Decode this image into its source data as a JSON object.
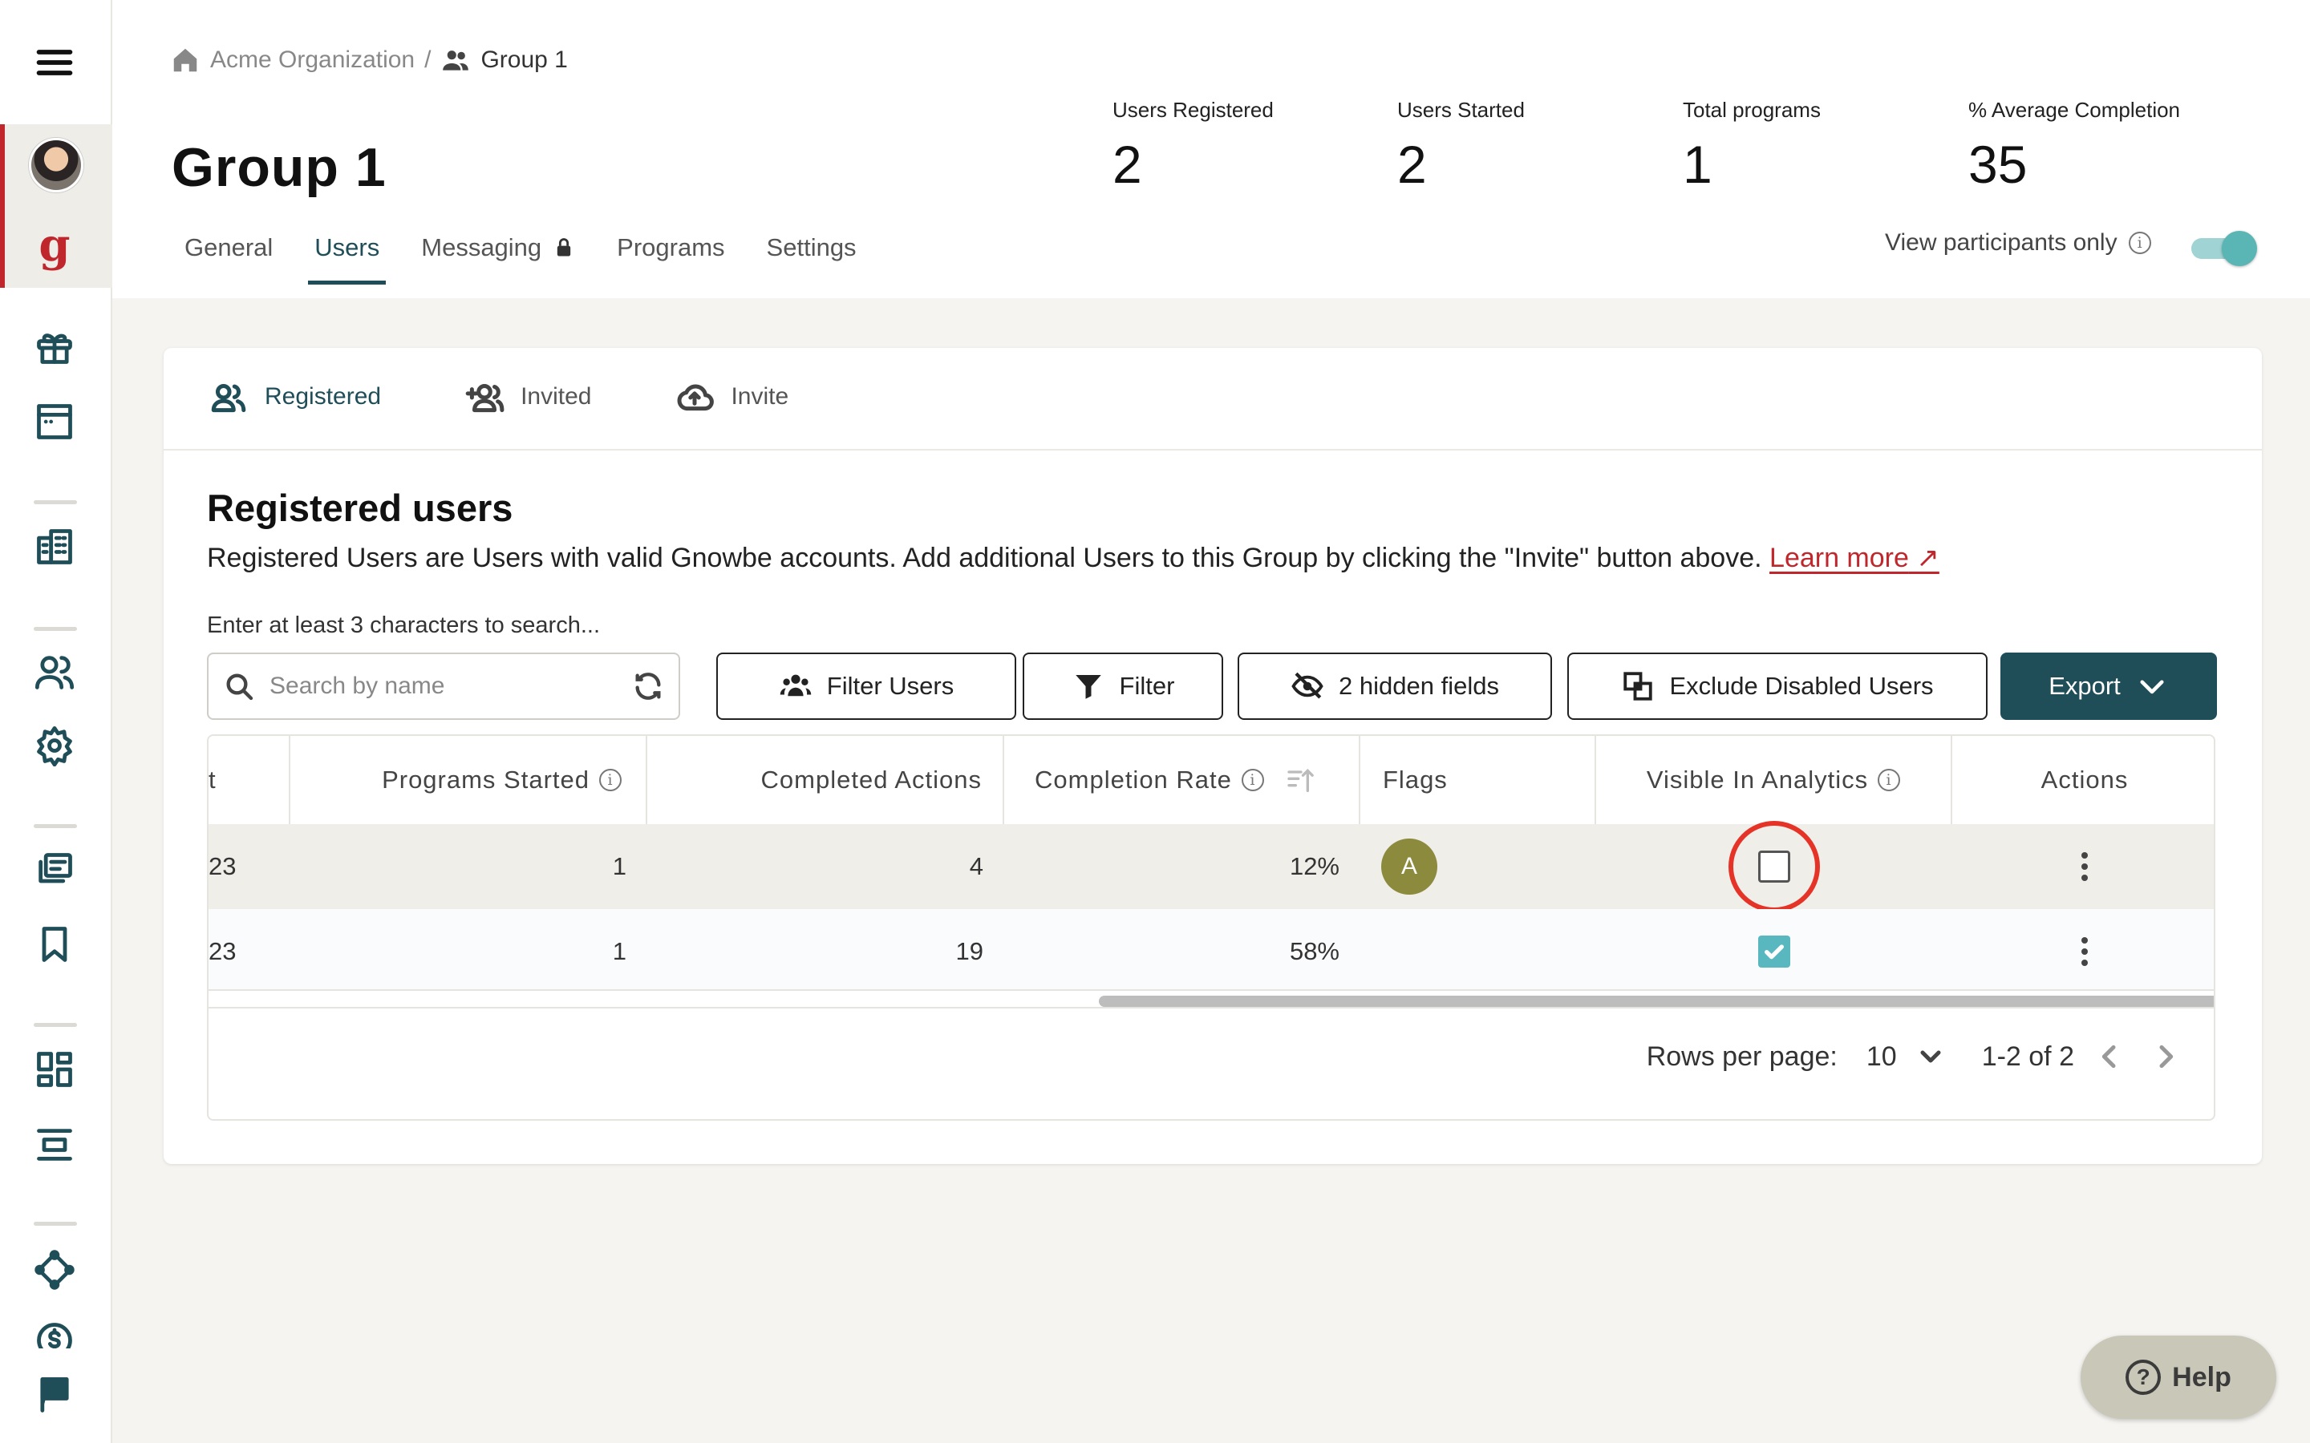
{
  "breadcrumb": {
    "org": "Acme Organization",
    "separator": "/",
    "group": "Group 1"
  },
  "page_title": "Group 1",
  "tabs": [
    {
      "label": "General"
    },
    {
      "label": "Users"
    },
    {
      "label": "Messaging"
    },
    {
      "label": "Programs"
    },
    {
      "label": "Settings"
    }
  ],
  "stats": [
    {
      "label": "Users Registered",
      "value": "2"
    },
    {
      "label": "Users Started",
      "value": "2"
    },
    {
      "label": "Total programs",
      "value": "1"
    },
    {
      "label": "% Average Completion",
      "value": "35"
    }
  ],
  "view_participants": {
    "label": "View participants only",
    "on": true
  },
  "subtabs": [
    {
      "label": "Registered"
    },
    {
      "label": "Invited"
    },
    {
      "label": "Invite"
    }
  ],
  "section": {
    "title": "Registered users",
    "description": "Registered Users are Users with valid Gnowbe accounts. Add additional Users to this Group by clicking the \"Invite\" button above.",
    "learn_more": "Learn more"
  },
  "search": {
    "hint": "Enter at least 3 characters to search...",
    "placeholder": "Search by name"
  },
  "toolbar": {
    "filter_users": "Filter Users",
    "filter": "Filter",
    "hidden_fields": "2 hidden fields",
    "exclude_disabled": "Exclude Disabled Users",
    "export": "Export"
  },
  "table": {
    "columns": {
      "truncated": "t",
      "programs_started": "Programs Started",
      "completed_actions": "Completed Actions",
      "completion_rate": "Completion Rate",
      "flags": "Flags",
      "visible_in_analytics": "Visible In Analytics",
      "actions": "Actions"
    },
    "rows": [
      {
        "truncated": "23",
        "programs_started": "1",
        "completed_actions": "4",
        "completion_rate": "12%",
        "flag": "A",
        "visible": false
      },
      {
        "truncated": "23",
        "programs_started": "1",
        "completed_actions": "19",
        "completion_rate": "58%",
        "flag": "",
        "visible": true
      }
    ]
  },
  "pagination": {
    "rows_label": "Rows per page:",
    "rows_value": "10",
    "range": "1-2 of 2"
  },
  "help": {
    "label": "Help"
  },
  "colors": {
    "brand": "#1f4e59",
    "accent_red": "#c0272d",
    "check": "#59b7c0",
    "highlight_ring": "#e53327"
  }
}
